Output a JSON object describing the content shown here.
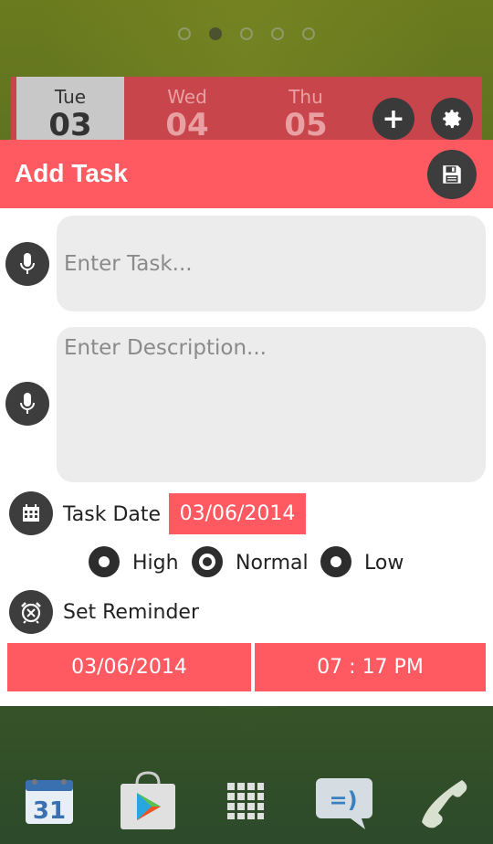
{
  "colors": {
    "accent": "#ff5a62",
    "widget": "#c9454c",
    "icon_bg": "#3d3d3d",
    "field_bg": "#ececec"
  },
  "page_indicator": {
    "count": 5,
    "active_index": 1
  },
  "widget": {
    "days": [
      {
        "name": "Tue",
        "num": "03",
        "selected": true
      },
      {
        "name": "Wed",
        "num": "04",
        "selected": false
      },
      {
        "name": "Thu",
        "num": "05",
        "selected": false
      }
    ],
    "add_icon": "plus-icon",
    "settings_icon": "gear-icon"
  },
  "dialog": {
    "title": "Add Task",
    "save_icon": "floppy-disk-icon",
    "task_placeholder": "Enter Task...",
    "description_placeholder": "Enter Description...",
    "task_date_label": "Task Date",
    "task_date_value": "03/06/2014",
    "priority": {
      "options": [
        "High",
        "Normal",
        "Low"
      ],
      "selected": "Normal"
    },
    "reminder_label": "Set Reminder",
    "reminder_date": "03/06/2014",
    "reminder_time": "07 : 17 PM"
  },
  "dock": {
    "calendar_number": "31",
    "items": [
      "calendar-icon",
      "play-store-icon",
      "app-drawer-icon",
      "messaging-icon",
      "phone-icon"
    ]
  }
}
